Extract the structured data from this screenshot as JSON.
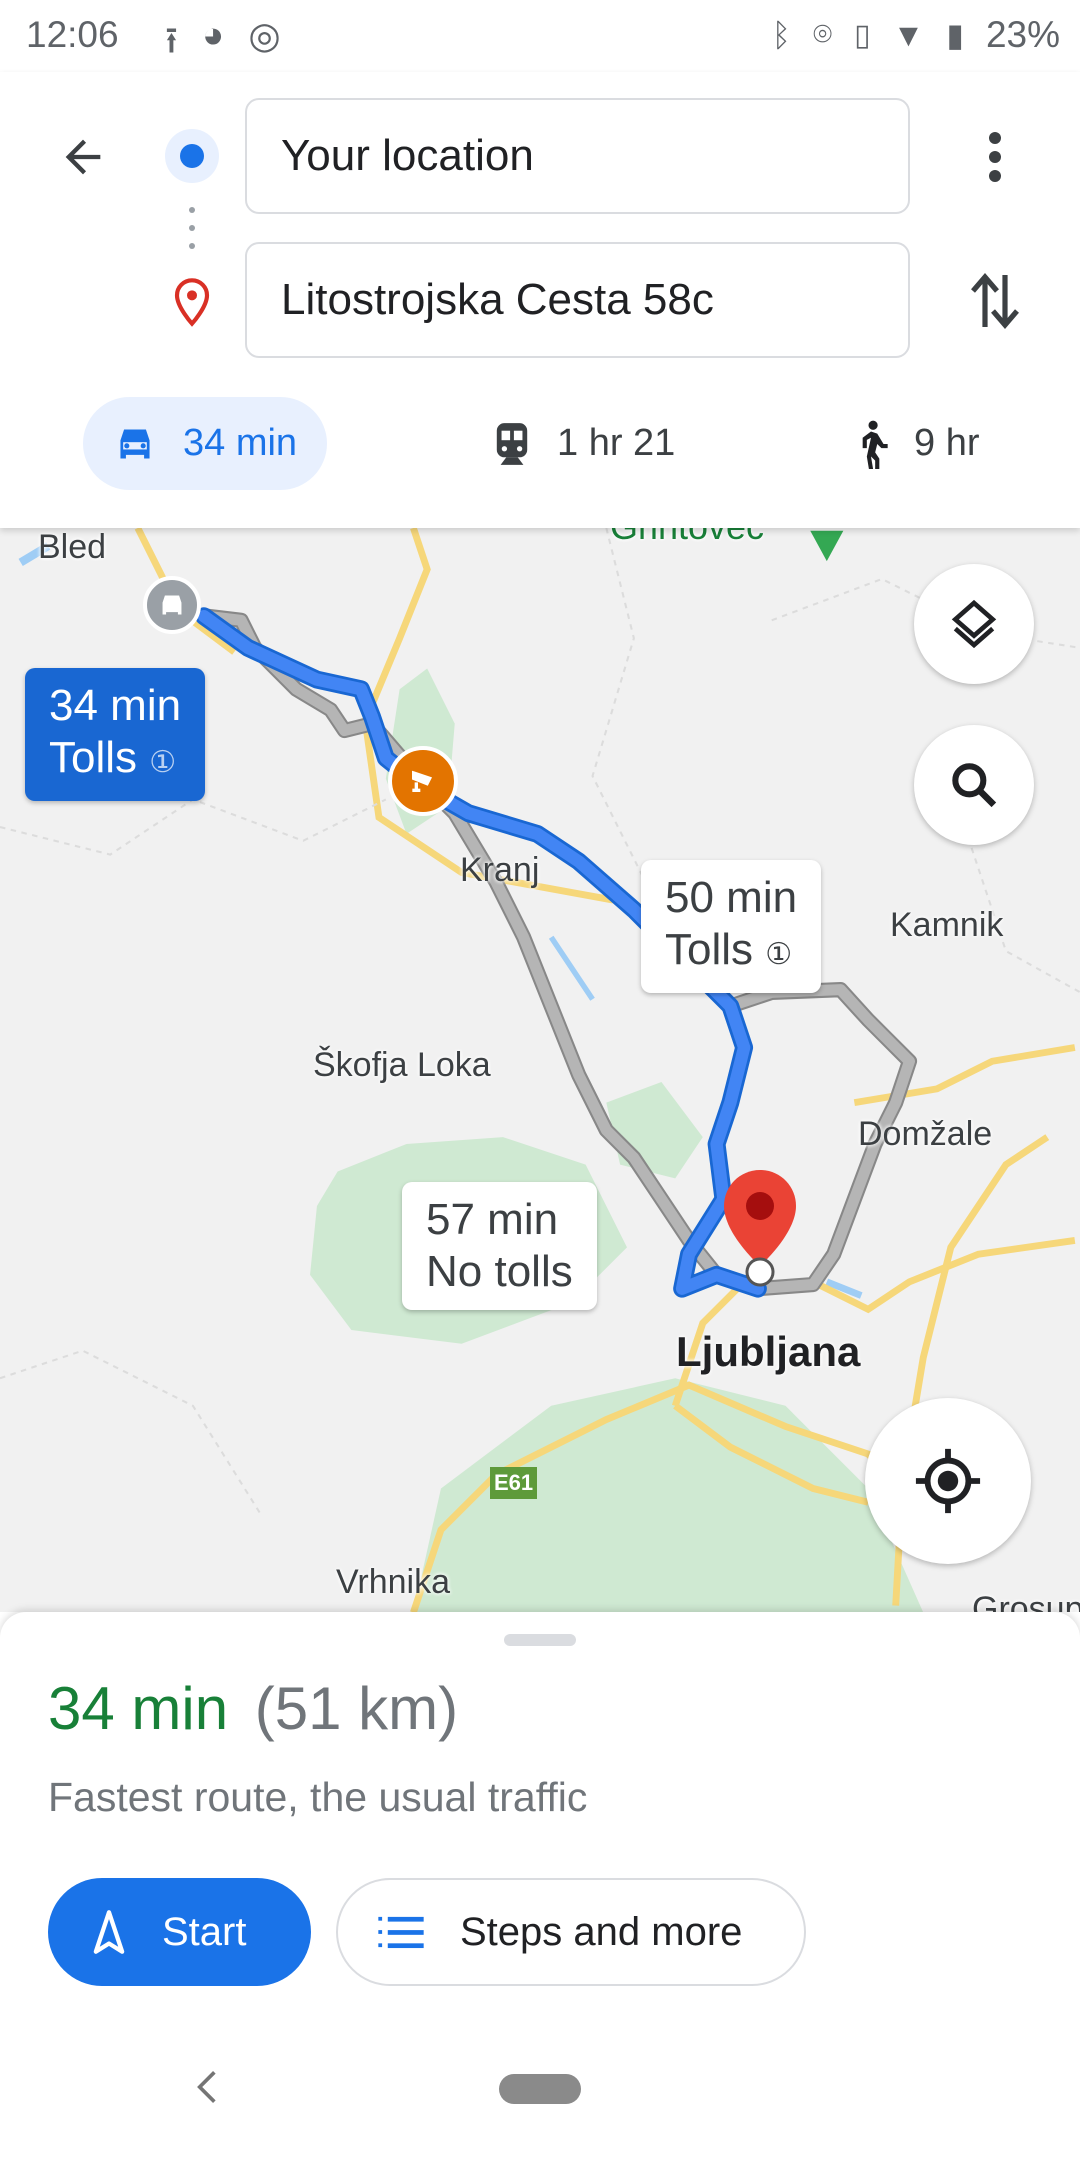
{
  "status_bar": {
    "time": "12:06",
    "battery": "23%",
    "icons": [
      "upload-icon",
      "app-icon",
      "app-icon-2",
      "bluetooth-icon",
      "location-icon",
      "vibrate-icon",
      "data-icon",
      "wifi-icon",
      "battery-charging-icon"
    ]
  },
  "directions": {
    "origin": "Your location",
    "destination": "Litostrojska Cesta 58c"
  },
  "modes": [
    {
      "icon": "car-icon",
      "label": "34 min",
      "selected": true
    },
    {
      "icon": "train-icon",
      "label": "1 hr 21"
    },
    {
      "icon": "walk-icon",
      "label": "9 hr"
    }
  ],
  "map": {
    "places": {
      "bled": "Bled",
      "grintovec": "Grintovec",
      "kranj": "Kranj",
      "kamnik": "Kamnik",
      "skofja_loka": "Škofja Loka",
      "domzale": "Domžale",
      "ljubljana": "Ljubljana",
      "vrhnika": "Vrhnika",
      "grosuplje": "Grosuplje",
      "e61": "E61"
    },
    "routes": [
      {
        "time": "34 min",
        "note": "Tolls",
        "selected": true
      },
      {
        "time": "50 min",
        "note": "Tolls"
      },
      {
        "time": "57 min",
        "note": "No tolls"
      }
    ],
    "colors": {
      "route_selected": "#4285f4",
      "route_alt": "#a8a8a8",
      "destination": "#ea4335",
      "camera": "#e37400"
    }
  },
  "sheet": {
    "duration": "34 min",
    "distance": "(51 km)",
    "description": "Fastest route, the usual traffic",
    "start": "Start",
    "steps": "Steps and more",
    "colors": {
      "duration": "#188038",
      "primary": "#1a73e8"
    }
  }
}
